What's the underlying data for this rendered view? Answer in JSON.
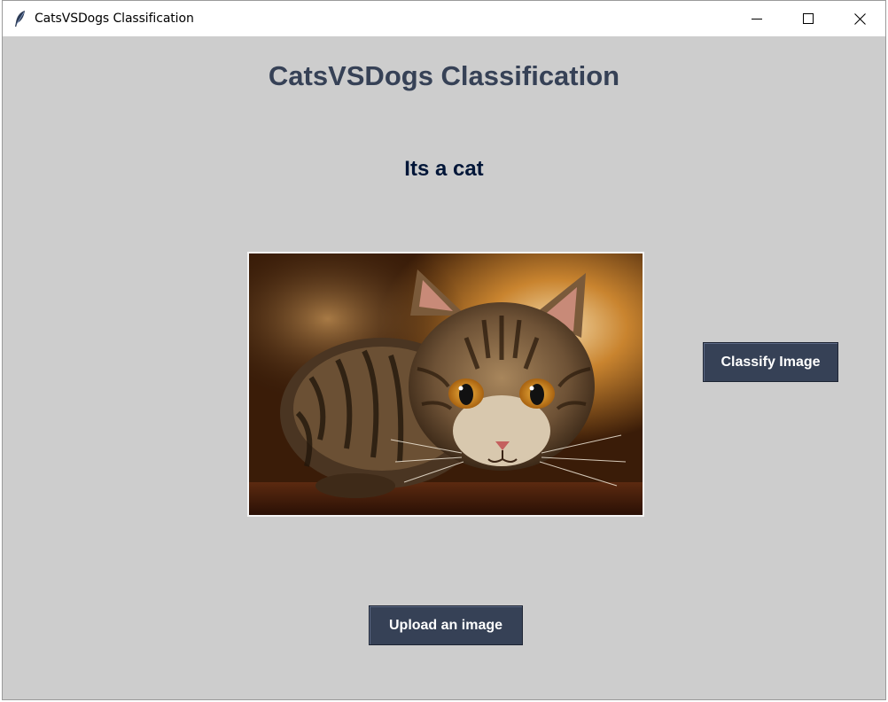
{
  "window": {
    "title": "CatsVSDogs Classification",
    "controls": {
      "minimize": "minimize-icon",
      "maximize": "maximize-icon",
      "close": "close-icon"
    }
  },
  "main": {
    "heading": "CatsVSDogs Classification",
    "result": "Its a cat",
    "classify_label": "Classify Image",
    "upload_label": "Upload an image"
  },
  "colors": {
    "window_bg": "#cdcdcd",
    "button_bg": "#364156",
    "heading_color": "#364156",
    "result_color": "#011638"
  }
}
